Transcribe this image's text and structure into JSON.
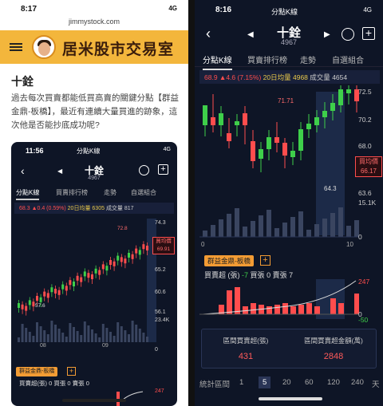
{
  "left": {
    "status_time": "8:17",
    "status_right": "4G",
    "url": "jimmystock.com",
    "banner_title": "居米股市交易室",
    "article_title": "十銓",
    "article_body": "過去每次買賣都能低買高賣的關鍵分點【群益金鼎-板橋】，最近有連續大量買進的跡象，這次他是否能抄底成功呢?",
    "inner": {
      "status_time": "11:56",
      "status_mid": "分點K線",
      "status_right": "4G",
      "stock_name": "十銓",
      "stock_code": "4967",
      "tabs": [
        "分點K線",
        "買賣排行榜",
        "走勢",
        "自選組合"
      ],
      "info_price": "68.3",
      "info_change": "▲0.4 (0.59%)",
      "info_ma_label": "20日均量",
      "info_ma": "6305",
      "info_vol_label": "成交量",
      "info_vol": "817",
      "axis": [
        "74.3",
        "65.2",
        "60.6",
        "56.1",
        "23.4K",
        "0"
      ],
      "price_badge_label": "買均價",
      "price_badge_value": "69.91",
      "high_label": "72.8",
      "low_label": "57.6",
      "x_labels": [
        "08",
        "09"
      ],
      "broker_tag": "群益金鼎-板橋",
      "plus": "+",
      "summary": "買賣超(張) 0 買張 0 賣張 0",
      "bottom_axis": "247"
    }
  },
  "right": {
    "status_time": "8:16",
    "status_mid": "分點K線",
    "status_right": "4G",
    "back": "‹",
    "prev": "◀",
    "next": "▶",
    "stock_name": "十銓",
    "stock_code": "4967",
    "tabs": [
      "分點K線",
      "買賣排行榜",
      "走勢",
      "自選組合"
    ],
    "info_price": "68.9",
    "info_change": "▲4.6 (7.15%)",
    "info_ma_label": "20日均量",
    "info_ma": "4968",
    "info_vol_label": "成交量",
    "info_vol": "4654",
    "axis": [
      "72.5",
      "70.2",
      "68.0",
      "63.6",
      "15.1K",
      "0"
    ],
    "price_badge_label": "買均價",
    "price_badge_value": "66.17",
    "high_label": "71.71",
    "low_label": "64.3",
    "x_labels": [
      "0",
      "10"
    ],
    "broker_tag": "群益金鼎-板橋",
    "plus": "+",
    "summary_label": "買賣超 (張)",
    "summary_net": "-7",
    "summary_buy_label": "買張",
    "summary_buy": "0",
    "summary_sell_label": "賣張",
    "summary_sell": "7",
    "bottom_axis": [
      "247",
      "0",
      "-50"
    ],
    "panel": {
      "left_caption": "區間買賣超(張)",
      "left_value": "431",
      "right_caption": "區間買賣超金額(萬)",
      "right_value": "2848"
    },
    "periods_label": "統計區間",
    "periods": [
      "1",
      "5",
      "20",
      "60",
      "120",
      "240",
      "天"
    ],
    "period_selected": "5"
  },
  "colors": {
    "up": "#ff4d4d",
    "down": "#3ecf4a",
    "accent": "#f39c34",
    "bg": "#0e1526",
    "banner": "#f3b63c"
  }
}
